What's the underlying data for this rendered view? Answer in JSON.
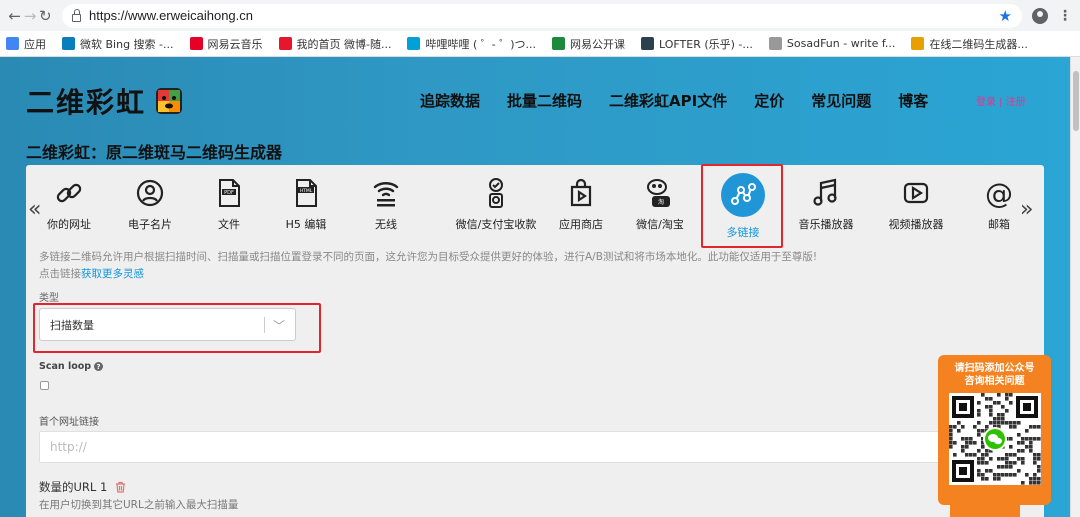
{
  "browser": {
    "url": "https://www.erweicaihong.cn",
    "bookmarks": [
      {
        "label": "应用",
        "icon": "apps-grid-icon",
        "color": "#4285f4"
      },
      {
        "label": "微软 Bing 搜索 -...",
        "icon": "bing-icon",
        "color": "#0a7ebd"
      },
      {
        "label": "网易云音乐",
        "icon": "netease-music-icon",
        "color": "#e60026"
      },
      {
        "label": "我的首页 微博-随...",
        "icon": "weibo-icon",
        "color": "#e6162d"
      },
      {
        "label": "哔哩哔哩 ( ゜- ゜)つ...",
        "icon": "bilibili-icon",
        "color": "#00a1d6"
      },
      {
        "label": "网易公开课",
        "icon": "netease-open-icon",
        "color": "#1b8a3a"
      },
      {
        "label": "LOFTER (乐乎) -...",
        "icon": "lofter-icon",
        "color": "#2c4150"
      },
      {
        "label": "SosadFun - write f...",
        "icon": "sosadfun-icon",
        "color": "#999999"
      },
      {
        "label": "在线二维码生成器...",
        "icon": "qr-generator-icon",
        "color": "#e8a000"
      }
    ]
  },
  "site": {
    "logo": "二维彩虹",
    "nav": [
      "追踪数据",
      "批量二维码",
      "二维彩虹API文件",
      "定价",
      "常见问题",
      "博客"
    ],
    "login": "登录 | 注册",
    "subtitle": "二维彩虹：原二维斑马二维码生成器"
  },
  "types": [
    {
      "label": "你的网址",
      "icon": "link-icon"
    },
    {
      "label": "电子名片",
      "icon": "contact-card-icon"
    },
    {
      "label": "文件",
      "icon": "pdf-file-icon"
    },
    {
      "label": "H5 编辑",
      "icon": "html-file-icon"
    },
    {
      "label": "无线",
      "icon": "wifi-icon"
    },
    {
      "label": "微信/支付宝收款",
      "icon": "payment-icon"
    },
    {
      "label": "应用商店",
      "icon": "app-store-icon"
    },
    {
      "label": "微信/淘宝",
      "icon": "wechat-icon"
    },
    {
      "label": "多链接",
      "icon": "multi-link-icon",
      "active": true
    },
    {
      "label": "音乐播放器",
      "icon": "music-icon"
    },
    {
      "label": "视频播放器",
      "icon": "video-play-icon"
    },
    {
      "label": "邮箱",
      "icon": "email-at-icon"
    }
  ],
  "form": {
    "description": "多链接二维码允许用户根据扫描时间、扫描量或扫描位置登录不同的页面，这允许您为目标受众提供更好的体验，进行A/B测试和将市场本地化。此功能仅适用于至尊版!",
    "inspiration_prefix": "点击链接",
    "inspiration_link": "获取更多灵感",
    "type_label": "类型",
    "type_value": "扫描数量",
    "scan_loop_label": "Scan loop",
    "first_url_label": "首个网址链接",
    "first_url_placeholder": "http://",
    "url1_label": "数量的URL 1",
    "url1_help": "在用户切换到其它URL之前输入最大扫描量"
  },
  "qr_widget": {
    "line1": "请扫码添加公众号",
    "line2": "咨询相关问题"
  },
  "colors": {
    "accent": "#2196d6",
    "highlight": "#e3262c",
    "widget": "#f58220",
    "banner": "#2f98c4"
  }
}
